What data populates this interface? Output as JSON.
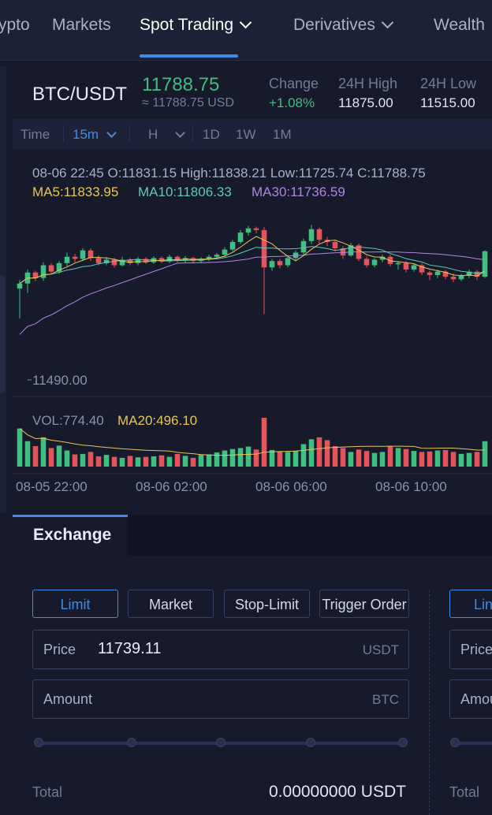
{
  "nav": {
    "items": [
      "ypto",
      "Markets",
      "Spot Trading",
      "Derivatives",
      "Wealth"
    ],
    "active_index": 2
  },
  "ticker": {
    "pair": "BTC/USDT",
    "last_price": "11788.75",
    "fiat_price": "≈ 11788.75 USD",
    "change_label": "Change",
    "change_value": "+1.08%",
    "high_label": "24H High",
    "high_value": "11875.00",
    "low_label": "24H Low",
    "low_value": "11515.00"
  },
  "toolbar": {
    "time_label": "Time",
    "interval": "15m",
    "h_label": "H",
    "ranges": [
      "1D",
      "1W",
      "1M"
    ]
  },
  "chart_info": {
    "ohlc": "08-06 22:45   O:11831.15  High:11838.21  Low:11725.74  C:11788.75",
    "ma5": "MA5:11833.95",
    "ma10": "MA10:11806.33",
    "ma30": "MA30:11736.59",
    "min_label": "11490.00",
    "vol": "VOL:774.40",
    "vol_ma20": "MA20:496.10",
    "time_labels": [
      "08-05 22:00",
      "08-06 02:00",
      "08-06 06:00",
      "08-06 10:00"
    ]
  },
  "colors": {
    "up": "#3fbf82",
    "down": "#e5545a",
    "ma5": "#e8c559",
    "ma10": "#5fc9bb",
    "ma30": "#b285e0",
    "accent": "#3d8de8"
  },
  "chart_data": {
    "type": "candlestick",
    "price_range": [
      11470,
      11860
    ],
    "candles": [
      [
        11700,
        11712,
        11630,
        11720
      ],
      [
        11712,
        11738,
        11690,
        11745
      ],
      [
        11738,
        11725,
        11718,
        11742
      ],
      [
        11725,
        11755,
        11718,
        11762
      ],
      [
        11755,
        11740,
        11735,
        11760
      ],
      [
        11740,
        11760,
        11735,
        11765
      ],
      [
        11760,
        11775,
        11752,
        11785
      ],
      [
        11775,
        11770,
        11762,
        11782
      ],
      [
        11770,
        11790,
        11765,
        11795
      ],
      [
        11790,
        11772,
        11765,
        11795
      ],
      [
        11772,
        11760,
        11755,
        11778
      ],
      [
        11760,
        11768,
        11755,
        11775
      ],
      [
        11768,
        11755,
        11750,
        11772
      ],
      [
        11755,
        11768,
        11752,
        11775
      ],
      [
        11768,
        11760,
        11755,
        11772
      ],
      [
        11760,
        11770,
        11755,
        11775
      ],
      [
        11770,
        11762,
        11758,
        11774
      ],
      [
        11762,
        11772,
        11758,
        11776
      ],
      [
        11772,
        11764,
        11760,
        11776
      ],
      [
        11764,
        11775,
        11760,
        11780
      ],
      [
        11775,
        11766,
        11762,
        11778
      ],
      [
        11766,
        11772,
        11760,
        11777
      ],
      [
        11772,
        11765,
        11760,
        11775
      ],
      [
        11765,
        11770,
        11760,
        11774
      ],
      [
        11770,
        11775,
        11765,
        11780
      ],
      [
        11775,
        11780,
        11770,
        11784
      ],
      [
        11780,
        11792,
        11775,
        11798
      ],
      [
        11792,
        11810,
        11788,
        11815
      ],
      [
        11810,
        11832,
        11805,
        11838
      ],
      [
        11832,
        11842,
        11825,
        11848
      ],
      [
        11842,
        11838,
        11830,
        11846
      ],
      [
        11838,
        11750,
        11640,
        11845
      ],
      [
        11750,
        11765,
        11742,
        11770
      ],
      [
        11765,
        11755,
        11748,
        11770
      ],
      [
        11755,
        11772,
        11750,
        11778
      ],
      [
        11772,
        11785,
        11765,
        11790
      ],
      [
        11785,
        11812,
        11780,
        11818
      ],
      [
        11812,
        11840,
        11805,
        11850
      ],
      [
        11840,
        11815,
        11805,
        11844
      ],
      [
        11815,
        11810,
        11800,
        11822
      ],
      [
        11810,
        11795,
        11788,
        11815
      ],
      [
        11795,
        11778,
        11770,
        11800
      ],
      [
        11778,
        11802,
        11775,
        11808
      ],
      [
        11802,
        11770,
        11765,
        11806
      ],
      [
        11770,
        11755,
        11750,
        11776
      ],
      [
        11755,
        11768,
        11750,
        11772
      ],
      [
        11768,
        11775,
        11762,
        11780
      ],
      [
        11775,
        11758,
        11752,
        11780
      ],
      [
        11758,
        11760,
        11745,
        11765
      ],
      [
        11760,
        11745,
        11738,
        11765
      ],
      [
        11745,
        11755,
        11740,
        11760
      ],
      [
        11755,
        11738,
        11732,
        11760
      ],
      [
        11738,
        11732,
        11720,
        11742
      ],
      [
        11732,
        11740,
        11725,
        11745
      ],
      [
        11740,
        11728,
        11722,
        11744
      ],
      [
        11728,
        11722,
        11715,
        11735
      ],
      [
        11722,
        11730,
        11718,
        11735
      ],
      [
        11730,
        11740,
        11725,
        11745
      ],
      [
        11740,
        11728,
        11720,
        11744
      ],
      [
        11728,
        11788,
        11725,
        11790
      ]
    ],
    "volumes": [
      780,
      520,
      420,
      600,
      380,
      430,
      330,
      250,
      260,
      300,
      210,
      240,
      200,
      180,
      220,
      190,
      200,
      210,
      230,
      200,
      260,
      220,
      180,
      240,
      250,
      290,
      330,
      360,
      380,
      410,
      350,
      1000,
      340,
      310,
      300,
      320,
      460,
      560,
      600,
      540,
      420,
      380,
      300,
      350,
      320,
      280,
      300,
      420,
      380,
      360,
      320,
      300,
      310,
      330,
      340,
      300,
      260,
      280,
      300,
      520
    ]
  },
  "exchange": {
    "tab_label": "Exchange",
    "order_types": [
      "Limit",
      "Market",
      "Stop-Limit",
      "Trigger Order"
    ],
    "order_types_right": [
      "Lin"
    ],
    "price_label": "Price",
    "price_value": "11739.11",
    "price_unit": "USDT",
    "amount_label": "Amount",
    "amount_unit": "BTC",
    "right_price_label": "Price",
    "right_amount_label": "Amou",
    "total_label": "Total",
    "total_value": "0.00000000 USDT"
  }
}
